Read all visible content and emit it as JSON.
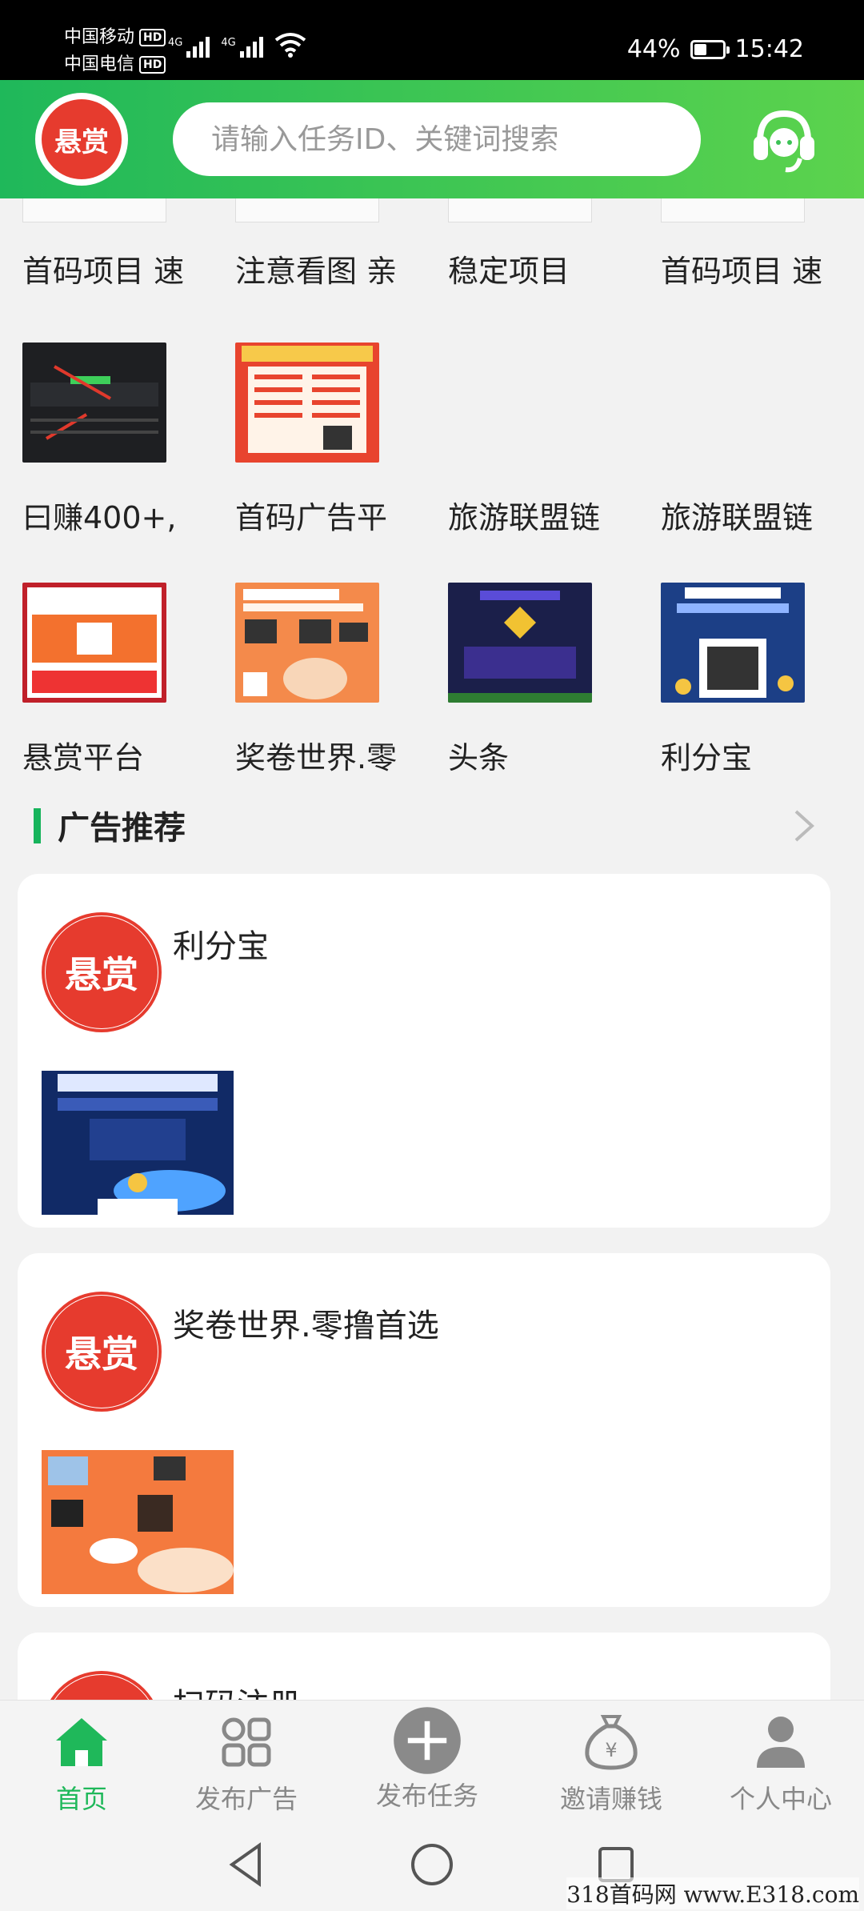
{
  "status_bar": {
    "carrier1": "中国移动",
    "carrier2": "中国电信",
    "hd": "HD",
    "network": "4G",
    "battery": "44%",
    "battery_level": 0.44,
    "time": "15:42"
  },
  "header": {
    "logo_text": "悬赏",
    "search_placeholder": "请输入任务ID、关键词搜索",
    "service_icon": "headset-icon"
  },
  "grid": {
    "rows": [
      [
        "首码项目 速",
        "注意看图 亲",
        "稳定项目",
        "首码项目 速"
      ],
      [
        "曰赚400+,",
        "首码广告平",
        "旅游联盟链",
        "旅游联盟链"
      ],
      [
        "悬赏平台",
        "奖卷世界.零",
        "头条",
        "利分宝"
      ]
    ]
  },
  "section": {
    "title": "广告推荐"
  },
  "cards": [
    {
      "title": "利分宝"
    },
    {
      "title": "奖卷世界.零撸首选"
    },
    {
      "title": "扫码注册"
    }
  ],
  "nav": [
    {
      "label": "首页",
      "icon": "home-icon"
    },
    {
      "label": "发布广告",
      "icon": "grid-icon"
    },
    {
      "label": "发布任务",
      "icon": "plus-circle-icon"
    },
    {
      "label": "邀请赚钱",
      "icon": "money-bag-icon"
    },
    {
      "label": "个人中心",
      "icon": "user-icon"
    }
  ],
  "colors": {
    "brand_green": "#1fb85a",
    "logo_red": "#e63b2e"
  },
  "watermark": "318首码网 www.E318.com"
}
